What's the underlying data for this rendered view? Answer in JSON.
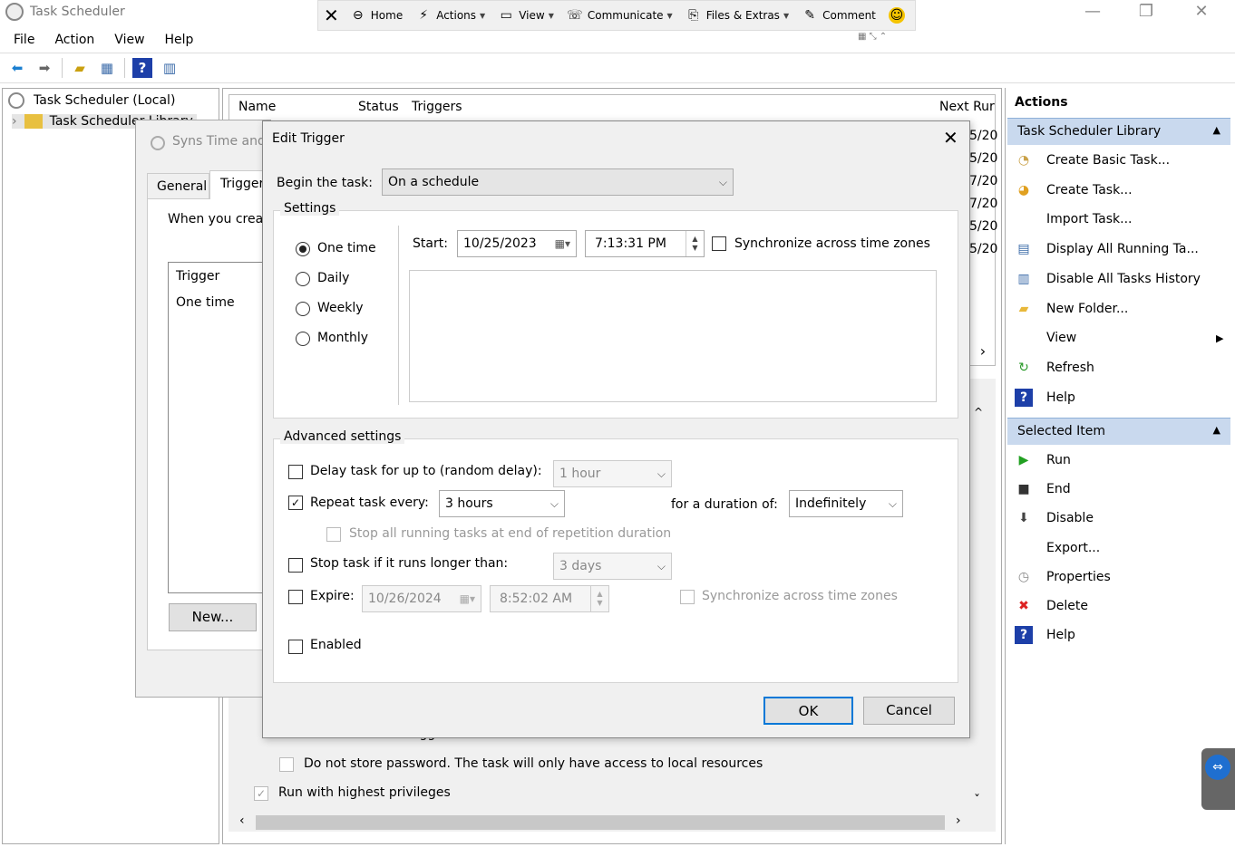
{
  "window": {
    "title": "Task Scheduler",
    "min": "—",
    "max": "❐",
    "close": "✕"
  },
  "remote": {
    "close": "✕",
    "items": [
      {
        "label": "Home",
        "icon": "⊖",
        "caret": false
      },
      {
        "label": "Actions",
        "icon": "⚡",
        "caret": true
      },
      {
        "label": "View",
        "icon": "▭",
        "caret": true
      },
      {
        "label": "Communicate",
        "icon": "☏",
        "caret": true
      },
      {
        "label": "Files & Extras",
        "icon": "⎘",
        "caret": true
      },
      {
        "label": "Comment",
        "icon": "✎",
        "caret": false
      }
    ],
    "smiley": "☺"
  },
  "menu": [
    "File",
    "Action",
    "View",
    "Help"
  ],
  "tree": {
    "root": "Task Scheduler (Local)",
    "library": "Task Scheduler Library",
    "expander": "›"
  },
  "list": {
    "columns": {
      "name": "Name",
      "status": "Status",
      "triggers": "Triggers",
      "next": "Next Rur"
    },
    "next_values": [
      "5/20",
      "5/20",
      "7/20",
      "7/20",
      "5/20",
      "5/20"
    ],
    "scroll_right": "›",
    "scroll_left": "‹",
    "scroll_up": "^",
    "scroll_down": "ˇ"
  },
  "lower_props": {
    "hidden_text": "Run whether user is logged on or not",
    "no_store": "Do not store password.  The task will only have access to local resources",
    "highest": "Run with highest privileges",
    "highest_check": "✓"
  },
  "props_window": {
    "title": "Syns Time and",
    "tabs": [
      "General",
      "Trigger"
    ],
    "when_text": "When you crea",
    "trigger_col": "Trigger",
    "trigger_val": "One time",
    "new_btn": "New..."
  },
  "actions": {
    "title": "Actions",
    "library_header": "Task Scheduler Library",
    "collapse": "▲",
    "library_items": [
      {
        "label": "Create Basic Task...",
        "icon": "◔",
        "color": "#caa24a"
      },
      {
        "label": "Create Task...",
        "icon": "◕",
        "color": "#e0a020"
      },
      {
        "label": "Import Task...",
        "icon": "",
        "color": "#000"
      },
      {
        "label": "Display All Running Ta...",
        "icon": "▤",
        "color": "#3a6aa8"
      },
      {
        "label": "Disable All Tasks History",
        "icon": "▥",
        "color": "#3a6aa8"
      },
      {
        "label": "New Folder...",
        "icon": "▰",
        "color": "#e8b83a"
      },
      {
        "label": "View",
        "icon": "",
        "color": "#000",
        "submenu": "▶"
      },
      {
        "label": "Refresh",
        "icon": "↻",
        "color": "#2a9a2a"
      },
      {
        "label": "Help",
        "icon": "?",
        "color": "#1d3fa8"
      }
    ],
    "selected_header": "Selected Item",
    "selected_items": [
      {
        "label": "Run",
        "icon": "▶",
        "color": "#22a022"
      },
      {
        "label": "End",
        "icon": "■",
        "color": "#333"
      },
      {
        "label": "Disable",
        "icon": "⬇",
        "color": "#444"
      },
      {
        "label": "Export...",
        "icon": "",
        "color": "#000"
      },
      {
        "label": "Properties",
        "icon": "◷",
        "color": "#888"
      },
      {
        "label": "Delete",
        "icon": "✖",
        "color": "#d22"
      },
      {
        "label": "Help",
        "icon": "?",
        "color": "#1d3fa8"
      }
    ]
  },
  "dialog": {
    "title": "Edit Trigger",
    "close": "✕",
    "begin_label": "Begin the task:",
    "begin_value": "On a schedule",
    "settings_label": "Settings",
    "schedule_options": [
      "One time",
      "Daily",
      "Weekly",
      "Monthly"
    ],
    "start_label": "Start:",
    "start_date": "10/25/2023",
    "start_time": "7:13:31 PM",
    "sync_label": "Synchronize across time zones",
    "advanced_label": "Advanced settings",
    "delay_label": "Delay task for up to (random delay):",
    "delay_value": "1 hour",
    "repeat_label": "Repeat task every:",
    "repeat_value": "3 hours",
    "repeat_check": "✓",
    "duration_label": "for a duration of:",
    "duration_value": "Indefinitely",
    "stop_all_label": "Stop all running tasks at end of repetition duration",
    "stop_long_label": "Stop task if it runs longer than:",
    "stop_long_value": "3 days",
    "expire_label": "Expire:",
    "expire_date": "10/26/2024",
    "expire_time": "8:52:02 AM",
    "expire_sync_label": "Synchronize across time zones",
    "enabled_label": "Enabled",
    "ok": "OK",
    "cancel": "Cancel"
  }
}
